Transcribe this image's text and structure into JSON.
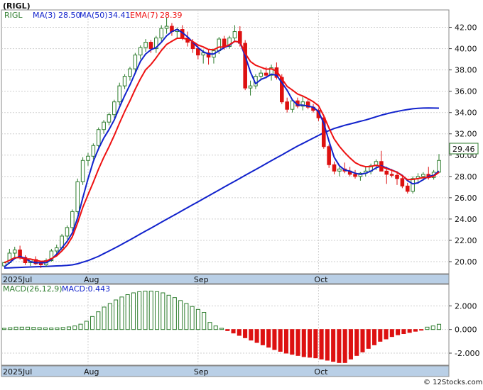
{
  "title": "(RIGL)",
  "credit": "© 12Stocks.com",
  "colors": {
    "up": "#2e7d2e",
    "down": "#dd1111",
    "ma_short": "#1122cc",
    "ma_long": "#1122cc",
    "ema": "#ee1111",
    "grid": "#cfcfcf",
    "axis_band": "#b9cfe6",
    "last_price_bg": "#ffffff"
  },
  "price_panel": {
    "legend": {
      "symbol": "RIGL",
      "ma3_label": "MA(3)",
      "ma3_value": "28.50",
      "ma50_label": "MA(50)",
      "ma50_value": "34.41",
      "ema7_label": "EMA(7)",
      "ema7_value": "28.39"
    },
    "last_price_label": "29.46",
    "yticks": [
      "42.00",
      "40.00",
      "38.00",
      "36.00",
      "34.00",
      "32.00",
      "30.00",
      "28.00",
      "26.00",
      "24.00",
      "22.00",
      "20.00"
    ]
  },
  "macd_panel": {
    "legend": {
      "label": "MACD(26,12,9)",
      "value_label": "MACD:0.443"
    },
    "yticks": [
      "2.000",
      "0.000",
      "-2.000"
    ]
  },
  "x_labels": [
    "2025Jul",
    "Aug",
    "Sep",
    "Oct"
  ],
  "chart_data": [
    {
      "type": "candlestick",
      "title": "(RIGL)",
      "ylim": [
        19.0,
        43.5
      ],
      "x_labels": [
        "2025Jul",
        "Aug",
        "Sep",
        "Oct"
      ],
      "candles": [
        [
          19.6,
          20.0,
          19.5,
          19.9
        ],
        [
          19.9,
          21.2,
          19.8,
          20.8
        ],
        [
          20.8,
          21.4,
          20.4,
          21.1
        ],
        [
          21.1,
          21.5,
          20.2,
          20.4
        ],
        [
          20.4,
          20.6,
          19.7,
          19.9
        ],
        [
          19.9,
          20.3,
          19.6,
          20.2
        ],
        [
          20.2,
          20.5,
          19.7,
          19.8
        ],
        [
          19.8,
          20.0,
          19.4,
          19.7
        ],
        [
          19.7,
          20.3,
          19.5,
          20.1
        ],
        [
          20.1,
          21.2,
          20.0,
          21.0
        ],
        [
          21.0,
          21.6,
          20.6,
          21.3
        ],
        [
          21.3,
          22.6,
          21.1,
          22.4
        ],
        [
          22.4,
          23.4,
          22.1,
          23.2
        ],
        [
          23.2,
          24.9,
          22.9,
          24.7
        ],
        [
          24.7,
          27.8,
          24.5,
          27.5
        ],
        [
          27.5,
          29.8,
          27.2,
          29.5
        ],
        [
          29.5,
          30.2,
          29.0,
          29.9
        ],
        [
          29.9,
          31.1,
          29.6,
          30.9
        ],
        [
          30.9,
          32.6,
          30.7,
          32.4
        ],
        [
          32.4,
          33.3,
          32.0,
          33.1
        ],
        [
          33.1,
          34.0,
          32.8,
          33.8
        ],
        [
          33.8,
          35.2,
          33.5,
          35.0
        ],
        [
          35.0,
          36.8,
          34.7,
          36.5
        ],
        [
          36.5,
          37.6,
          36.2,
          37.4
        ],
        [
          37.4,
          38.3,
          37.0,
          38.1
        ],
        [
          38.1,
          39.6,
          37.8,
          39.4
        ],
        [
          39.4,
          40.3,
          39.0,
          40.1
        ],
        [
          40.1,
          40.9,
          39.7,
          40.6
        ],
        [
          40.6,
          40.8,
          39.6,
          40.0
        ],
        [
          40.0,
          41.2,
          39.6,
          41.0
        ],
        [
          41.0,
          42.2,
          40.6,
          41.9
        ],
        [
          41.9,
          42.9,
          41.4,
          42.1
        ],
        [
          42.1,
          42.4,
          41.2,
          41.6
        ],
        [
          41.6,
          42.0,
          41.0,
          41.8
        ],
        [
          41.8,
          42.2,
          40.8,
          41.0
        ],
        [
          41.0,
          41.6,
          40.2,
          40.6
        ],
        [
          40.6,
          40.9,
          39.6,
          40.0
        ],
        [
          40.0,
          40.4,
          39.0,
          39.4
        ],
        [
          39.4,
          39.9,
          38.6,
          39.6
        ],
        [
          39.6,
          39.9,
          38.5,
          39.2
        ],
        [
          39.2,
          40.0,
          38.6,
          39.8
        ],
        [
          39.8,
          41.1,
          39.5,
          40.9
        ],
        [
          40.9,
          41.2,
          39.9,
          40.2
        ],
        [
          40.2,
          41.2,
          40.0,
          41.0
        ],
        [
          41.0,
          42.2,
          40.6,
          41.6
        ],
        [
          41.6,
          42.1,
          40.2,
          40.5
        ],
        [
          40.5,
          40.8,
          36.1,
          36.3
        ],
        [
          36.3,
          37.0,
          35.6,
          36.5
        ],
        [
          36.5,
          37.6,
          36.2,
          37.4
        ],
        [
          37.4,
          38.0,
          37.0,
          37.7
        ],
        [
          37.7,
          38.3,
          37.2,
          37.5
        ],
        [
          37.5,
          38.5,
          37.0,
          38.2
        ],
        [
          38.2,
          38.7,
          37.1,
          37.3
        ],
        [
          37.3,
          37.6,
          34.8,
          35.0
        ],
        [
          35.0,
          35.4,
          34.0,
          34.3
        ],
        [
          34.3,
          35.3,
          34.0,
          35.1
        ],
        [
          35.1,
          35.4,
          34.4,
          34.6
        ],
        [
          34.6,
          35.6,
          34.2,
          35.0
        ],
        [
          35.0,
          35.3,
          34.3,
          34.5
        ],
        [
          34.5,
          34.8,
          34.0,
          34.2
        ],
        [
          34.2,
          34.4,
          33.2,
          33.5
        ],
        [
          33.5,
          33.8,
          30.6,
          30.8
        ],
        [
          30.8,
          31.0,
          28.8,
          29.1
        ],
        [
          29.1,
          29.4,
          28.2,
          28.5
        ],
        [
          28.5,
          28.9,
          28.0,
          28.7
        ],
        [
          28.7,
          29.3,
          28.3,
          28.5
        ],
        [
          28.5,
          28.9,
          28.0,
          28.2
        ],
        [
          28.2,
          28.6,
          27.8,
          28.0
        ],
        [
          28.0,
          28.4,
          27.6,
          28.3
        ],
        [
          28.3,
          28.9,
          28.0,
          28.5
        ],
        [
          28.5,
          29.2,
          28.2,
          29.0
        ],
        [
          29.0,
          29.6,
          28.6,
          29.4
        ],
        [
          29.4,
          30.4,
          29.0,
          28.5
        ],
        [
          28.5,
          28.9,
          27.3,
          28.2
        ],
        [
          28.2,
          28.7,
          27.9,
          28.1
        ],
        [
          28.1,
          28.5,
          27.2,
          27.8
        ],
        [
          27.8,
          28.0,
          26.9,
          27.1
        ],
        [
          27.1,
          27.4,
          26.4,
          26.6
        ],
        [
          26.6,
          28.0,
          26.4,
          27.8
        ],
        [
          27.8,
          28.3,
          27.3,
          28.0
        ],
        [
          28.0,
          28.4,
          27.6,
          28.2
        ],
        [
          28.2,
          28.9,
          27.7,
          27.9
        ],
        [
          27.9,
          28.6,
          27.7,
          28.4
        ],
        [
          28.4,
          30.1,
          28.3,
          29.5
        ]
      ],
      "series": [
        {
          "name": "MA(3)",
          "values": [
            19.5,
            19.9,
            20.3,
            20.5,
            20.3,
            20.0,
            19.9,
            19.9,
            19.9,
            20.2,
            20.7,
            21.3,
            21.9,
            22.7,
            24.1,
            26.0,
            27.8,
            29.4,
            30.6,
            31.6,
            32.4,
            33.3,
            34.5,
            35.6,
            36.6,
            37.7,
            38.8,
            39.5,
            39.9,
            40.1,
            40.6,
            41.2,
            41.6,
            41.8,
            41.5,
            41.1,
            40.6,
            40.1,
            39.7,
            39.5,
            39.5,
            39.8,
            40.1,
            40.3,
            40.7,
            40.6,
            39.3,
            37.8,
            36.7,
            37.1,
            37.3,
            37.6,
            37.5,
            36.8,
            36.1,
            35.2,
            34.7,
            34.7,
            34.6,
            34.5,
            34.1,
            33.0,
            31.3,
            29.8,
            29.0,
            28.6,
            28.5,
            28.3,
            28.2,
            28.3,
            28.5,
            28.8,
            29.0,
            28.8,
            28.6,
            28.4,
            28.1,
            27.6,
            27.3,
            27.4,
            27.7,
            28.0,
            28.1,
            28.5
          ]
        },
        {
          "name": "MA(50)",
          "values": [
            19.4,
            19.42,
            19.44,
            19.46,
            19.48,
            19.5,
            19.52,
            19.53,
            19.55,
            19.57,
            19.6,
            19.62,
            19.65,
            19.7,
            19.8,
            19.95,
            20.1,
            20.3,
            20.5,
            20.75,
            21.0,
            21.25,
            21.5,
            21.78,
            22.05,
            22.32,
            22.6,
            22.88,
            23.15,
            23.42,
            23.7,
            23.98,
            24.25,
            24.52,
            24.8,
            25.08,
            25.35,
            25.62,
            25.9,
            26.18,
            26.45,
            26.72,
            27.0,
            27.28,
            27.55,
            27.82,
            28.1,
            28.38,
            28.65,
            28.92,
            29.2,
            29.48,
            29.75,
            30.02,
            30.3,
            30.58,
            30.85,
            31.1,
            31.35,
            31.6,
            31.85,
            32.1,
            32.3,
            32.5,
            32.65,
            32.8,
            32.92,
            33.05,
            33.18,
            33.3,
            33.45,
            33.6,
            33.75,
            33.88,
            34.0,
            34.1,
            34.2,
            34.28,
            34.35,
            34.4,
            34.42,
            34.43,
            34.42,
            34.41
          ]
        },
        {
          "name": "EMA(7)"
        }
      ]
    },
    {
      "type": "bar",
      "title": "MACD(26,12,9)",
      "ylim": [
        -2.9,
        3.7
      ],
      "x_labels": [
        "2025Jul",
        "Aug",
        "Sep",
        "Oct"
      ],
      "values": [
        0.1,
        0.15,
        0.2,
        0.2,
        0.2,
        0.18,
        0.16,
        0.14,
        0.13,
        0.14,
        0.17,
        0.22,
        0.3,
        0.45,
        0.7,
        1.1,
        1.5,
        1.9,
        2.2,
        2.5,
        2.75,
        2.95,
        3.1,
        3.2,
        3.25,
        3.25,
        3.2,
        3.1,
        2.9,
        2.7,
        2.45,
        2.2,
        1.95,
        1.7,
        1.45,
        0.6,
        0.3,
        0.1,
        -0.1,
        -0.3,
        -0.5,
        -0.7,
        -0.9,
        -1.1,
        -1.3,
        -1.5,
        -1.7,
        -1.85,
        -2.0,
        -2.1,
        -2.2,
        -2.3,
        -2.35,
        -2.4,
        -2.5,
        -2.6,
        -2.7,
        -2.8,
        -2.8,
        -2.5,
        -2.2,
        -1.9,
        -1.6,
        -1.3,
        -1.0,
        -0.8,
        -0.6,
        -0.45,
        -0.35,
        -0.25,
        -0.15,
        -0.05,
        0.2,
        0.3,
        0.443
      ]
    }
  ]
}
